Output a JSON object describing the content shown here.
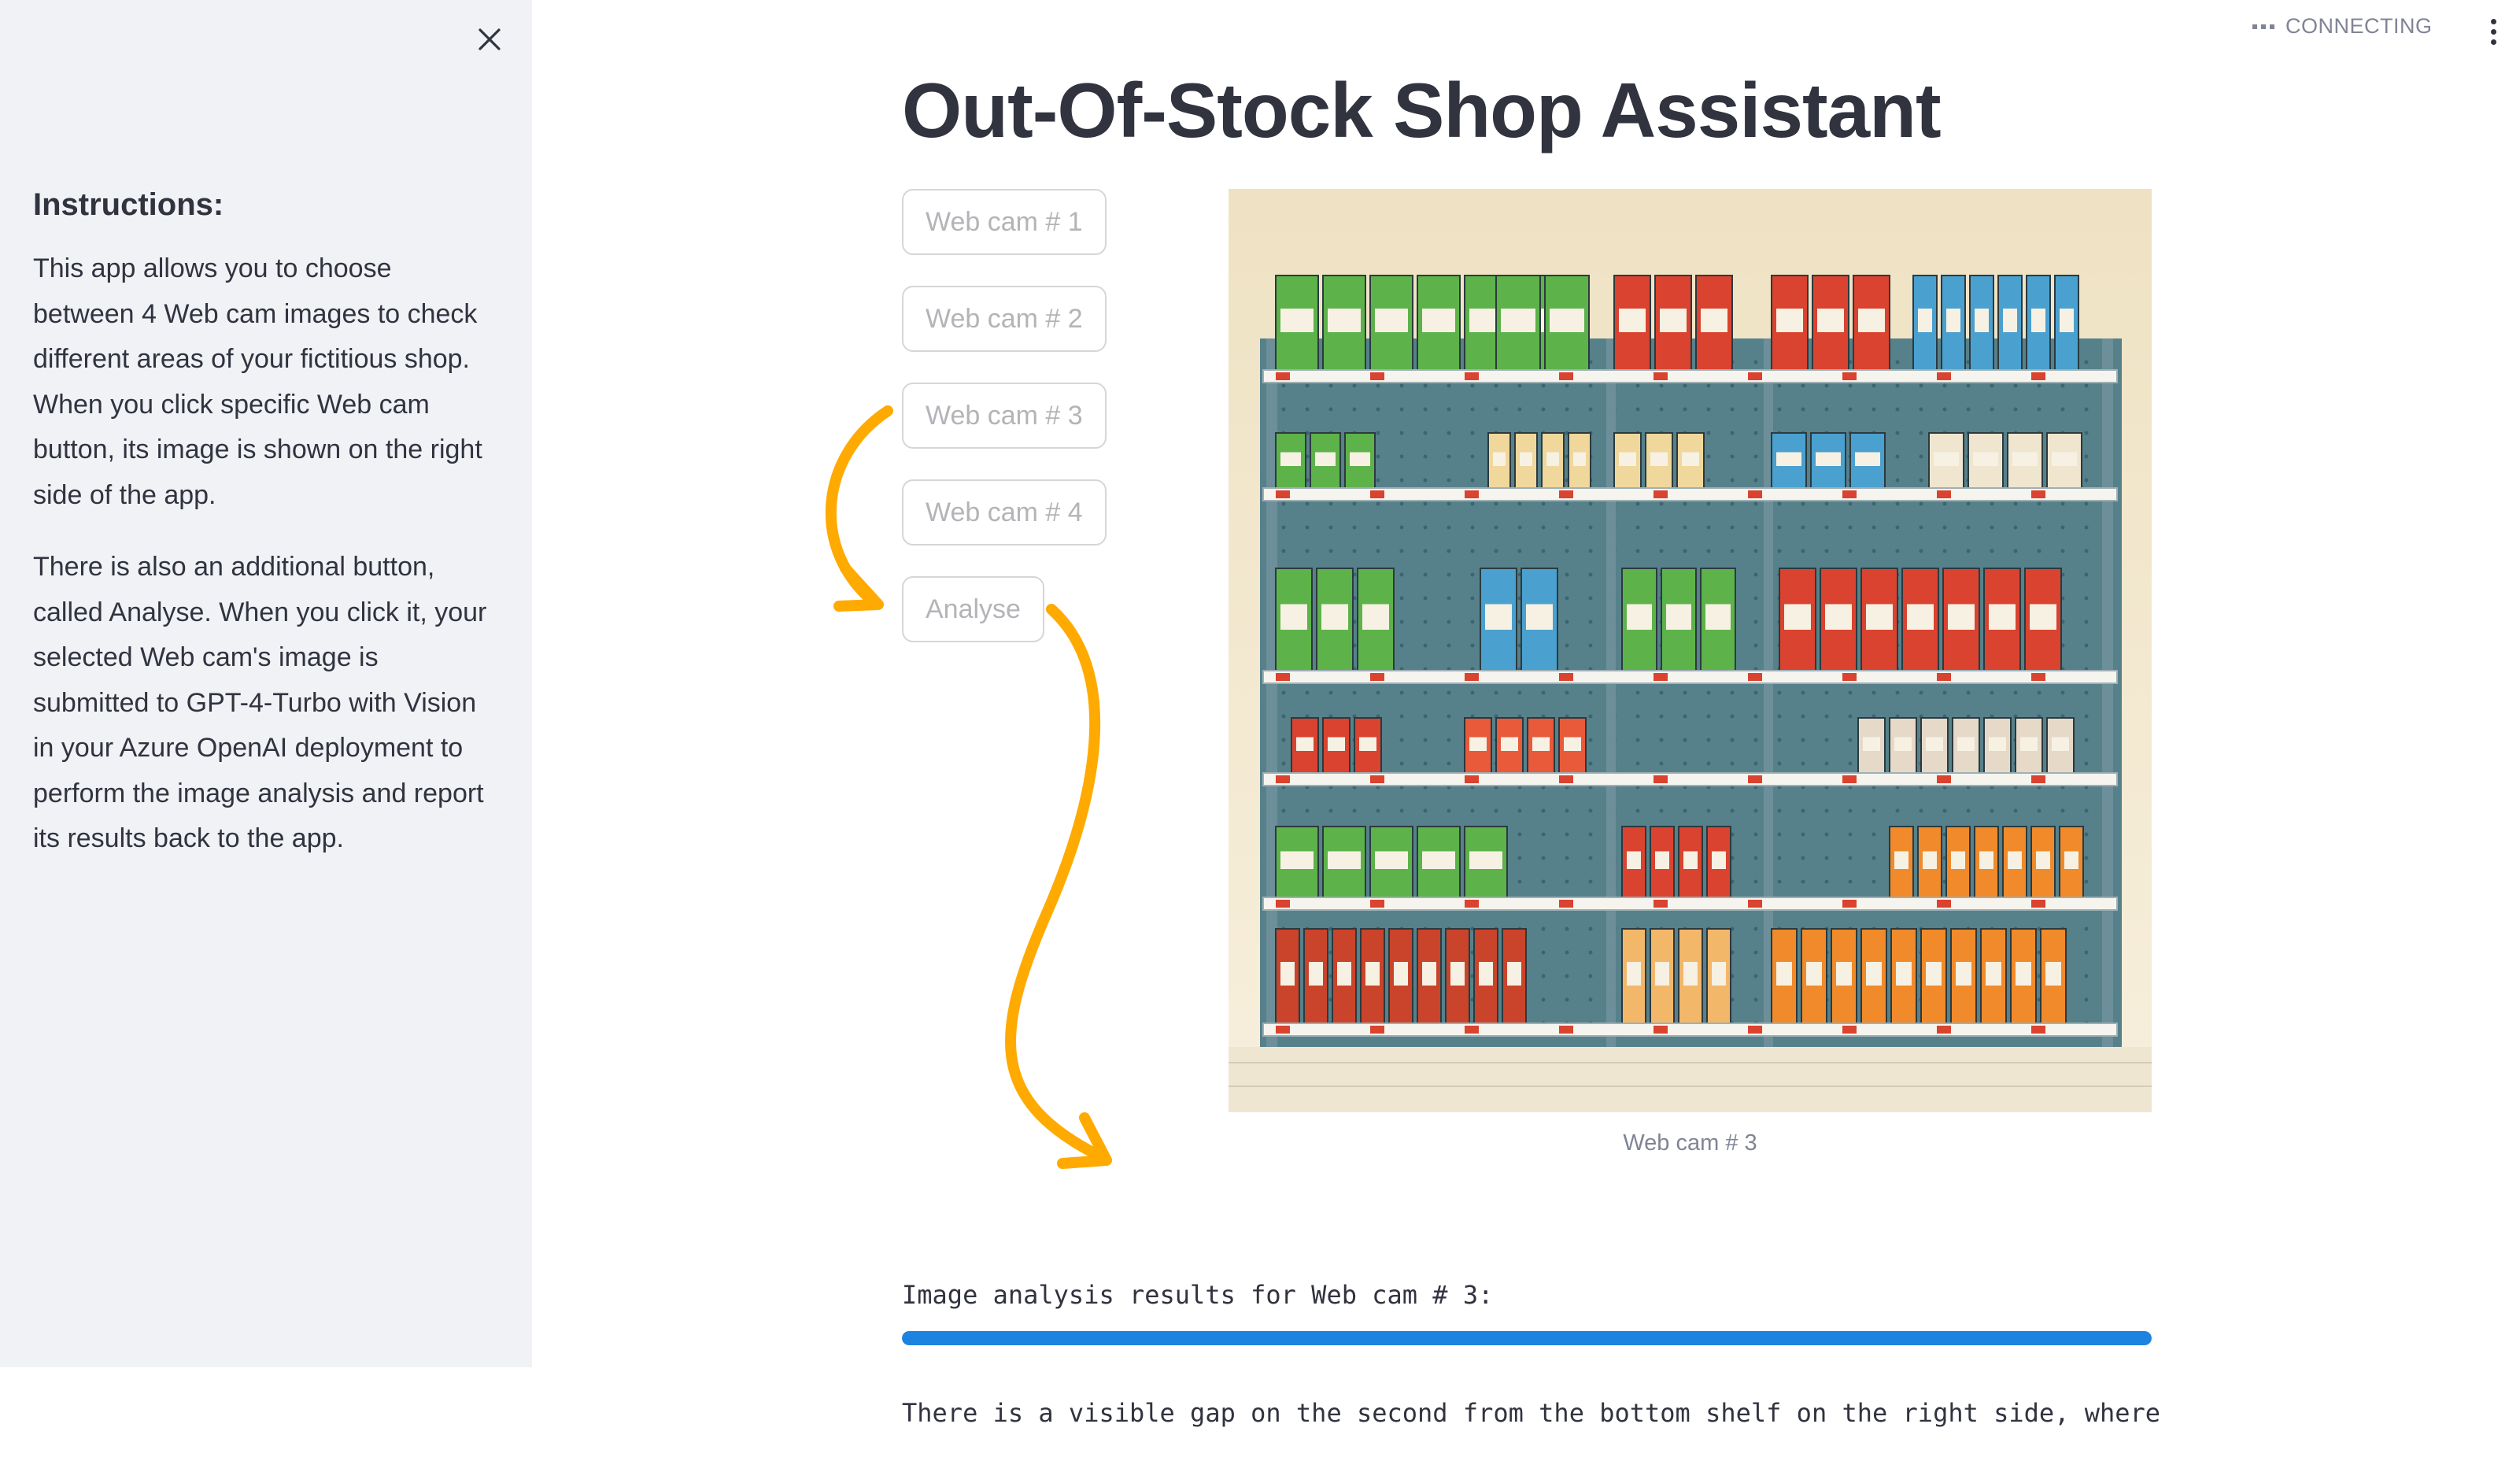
{
  "sidebar": {
    "heading": "Instructions:",
    "paragraphs": [
      "This app allows you to choose between 4 Web cam images to check different areas of your fictitious shop. When you click specific Web cam button, its image is shown on the right side of the app.",
      "There is also an additional button, called Analyse. When you click it, your selected Web cam's image is submitted to GPT-4-Turbo with Vision in your Azure OpenAI deployment to perform the image analysis and report its results back to the app."
    ]
  },
  "header": {
    "status": "CONNECTING"
  },
  "main": {
    "title": "Out-Of-Stock Shop Assistant",
    "buttons": [
      "Web cam # 1",
      "Web cam # 2",
      "Web cam # 3",
      "Web cam # 4",
      "Analyse"
    ],
    "image_caption": "Web cam # 3",
    "results": {
      "line1": "Image analysis results for Web cam # 3:",
      "line2": "There is a visible gap on the second from the bottom shelf on the right side, where"
    },
    "progress": 1.0
  },
  "colors": {
    "accent": "#1c83e1",
    "annotation_arrow": "#ffaa00",
    "sidebar_bg": "#f0f2f6"
  }
}
